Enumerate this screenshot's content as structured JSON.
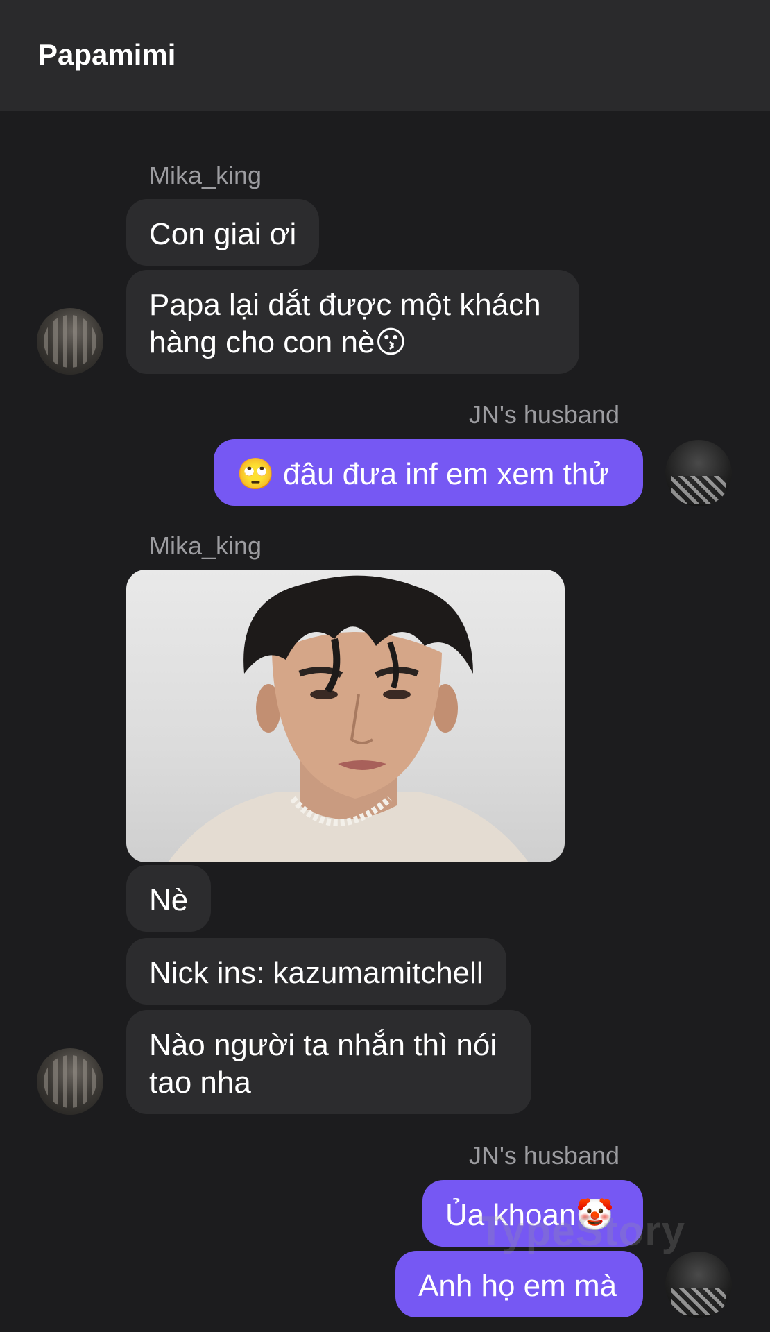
{
  "header": {
    "title": "Papamimi"
  },
  "messages": {
    "group1": {
      "sender": "Mika_king",
      "bubble1": "Con giai ơi",
      "bubble2": "Papa lại dắt được một khách hàng cho con nè😗"
    },
    "group2": {
      "sender": "JN's husband",
      "bubble1": "🙄 đâu đưa inf em xem thử"
    },
    "group3": {
      "sender": "Mika_king",
      "bubble1": "Nè",
      "bubble2": "Nick ins: kazumamitchell",
      "bubble3": "Nào người ta nhắn thì nói tao nha"
    },
    "group4": {
      "sender": "JN's husband",
      "bubble1": "Ủa khoan🤡",
      "bubble2": "Anh họ em mà"
    }
  },
  "watermark": "TypeStory",
  "colors": {
    "background": "#1c1c1e",
    "header": "#2a2a2c",
    "incoming_bubble": "#2c2c2e",
    "outgoing_bubble": "#7658f3",
    "sender_label": "#9c9ca0"
  },
  "icons": {
    "avatar_incoming": "avatar-mika-king",
    "avatar_outgoing": "avatar-jn-husband"
  }
}
